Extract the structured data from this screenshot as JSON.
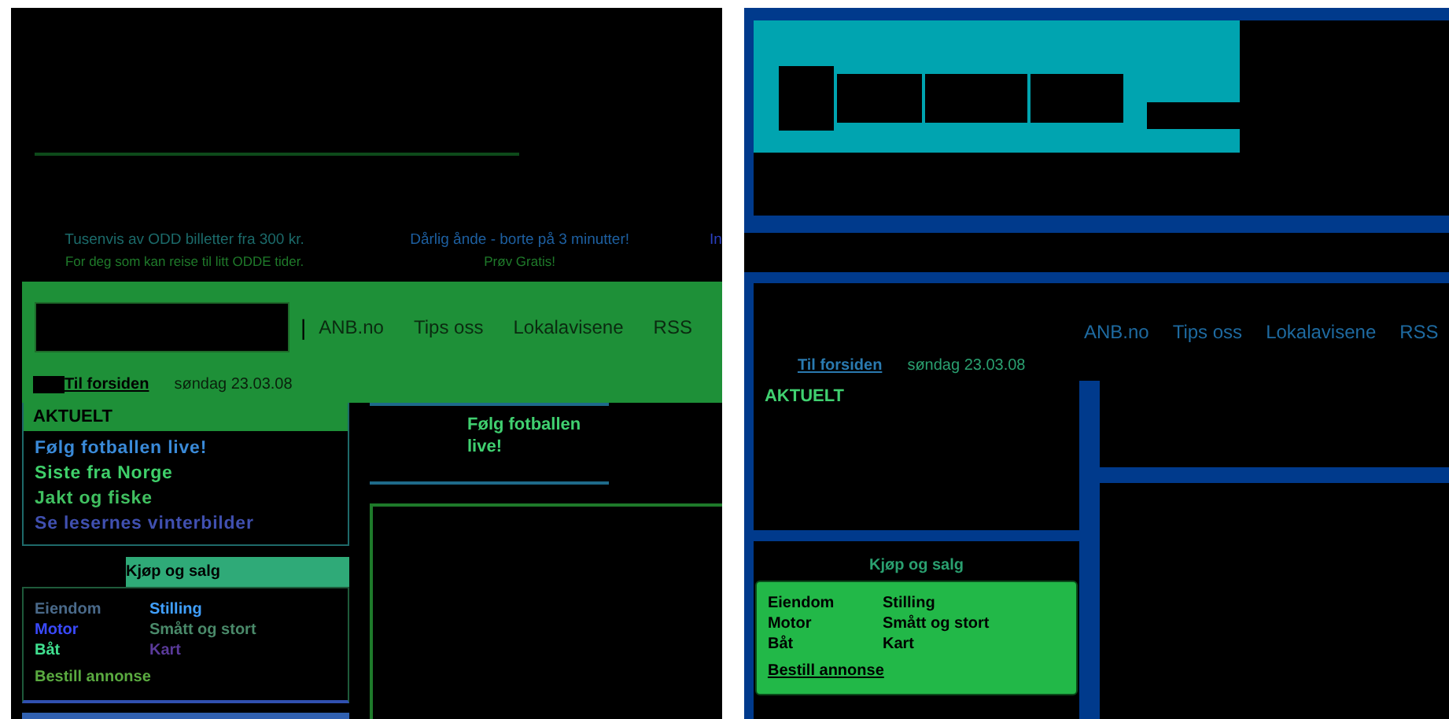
{
  "left_view": {
    "ads": [
      {
        "headline": "Tusenvis av ODD billetter fra 300 kr.",
        "subline": "For deg som kan reise til litt ODDE tider."
      },
      {
        "headline": "Dårlig ånde - borte på 3 minutter!",
        "subline": "Prøv Gratis!"
      },
      {
        "headline": "In"
      }
    ],
    "nav": {
      "separator": "|",
      "links": [
        "ANB.no",
        "Tips oss",
        "Lokalavisene",
        "RSS"
      ]
    },
    "home_link": "Til forsiden",
    "date": "søndag 23.03.08",
    "aktuelt": {
      "title": "AKTUELT",
      "items": [
        "Følg fotballen live!",
        "Siste fra Norge",
        "Jakt og fiske",
        "Se lesernes vinterbilder"
      ]
    },
    "classifieds": {
      "title": "Kjøp og salg",
      "links": [
        "Eiendom",
        "Stilling",
        "Motor",
        "Smått og stort",
        "Båt",
        "Kart"
      ],
      "order_link": "Bestill annonse"
    },
    "feature": {
      "headline": "Følg fotballen live!"
    }
  },
  "right_view": {
    "nav": {
      "links": [
        "ANB.no",
        "Tips oss",
        "Lokalavisene",
        "RSS"
      ]
    },
    "home_link": "Til forsiden",
    "date": "søndag 23.03.08",
    "aktuelt": {
      "title": "AKTUELT"
    },
    "classifieds": {
      "title": "Kjøp og salg",
      "links": [
        "Eiendom",
        "Stilling",
        "Motor",
        "Smått og stort",
        "Båt",
        "Kart"
      ],
      "order_link": "Bestill annonse"
    }
  }
}
